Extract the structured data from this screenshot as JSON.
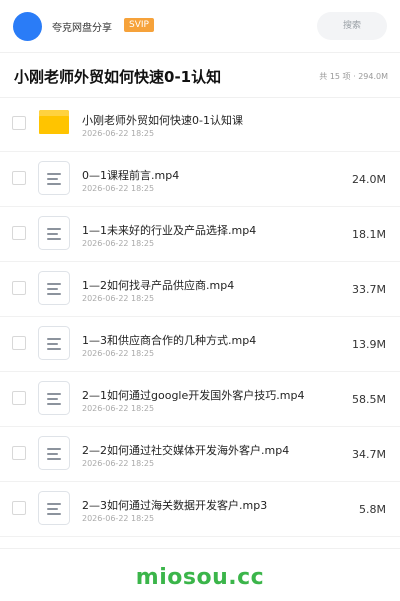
{
  "header": {
    "app_name": "夸克网盘分享",
    "badge": "SVIP",
    "search_label": "搜索",
    "accent_color": "#2a7cf7",
    "badge_color": "#f6a23a"
  },
  "folder": {
    "title": "小刚老师外贸如何快速0-1认知",
    "meta": "共 15 项 · 294.0M"
  },
  "files": [
    {
      "name": "小刚老师外贸如何快速0-1认知课",
      "date": "2026-06-22 18:25",
      "size": "",
      "icon": "folder-icon"
    },
    {
      "name": "0—1课程前言.mp4",
      "date": "2026-06-22 18:25",
      "size": "24.0M",
      "icon": "video-file-icon"
    },
    {
      "name": "1—1未来好的行业及产品选择.mp4",
      "date": "2026-06-22 18:25",
      "size": "18.1M",
      "icon": "video-file-icon"
    },
    {
      "name": "1—2如何找寻产品供应商.mp4",
      "date": "2026-06-22 18:25",
      "size": "33.7M",
      "icon": "video-file-icon"
    },
    {
      "name": "1—3和供应商合作的几种方式.mp4",
      "date": "2026-06-22 18:25",
      "size": "13.9M",
      "icon": "video-file-icon"
    },
    {
      "name": "2—1如何通过google开发国外客户技巧.mp4",
      "date": "2026-06-22 18:25",
      "size": "58.5M",
      "icon": "video-file-icon"
    },
    {
      "name": "2—2如何通过社交媒体开发海外客户.mp4",
      "date": "2026-06-22 18:25",
      "size": "34.7M",
      "icon": "video-file-icon"
    },
    {
      "name": "2—3如何通过海关数据开发客户.mp3",
      "date": "2026-06-22 18:25",
      "size": "5.8M",
      "icon": "audio-file-icon"
    }
  ],
  "watermark": {
    "text": "miosou.cc",
    "color": "#3bb54a"
  }
}
